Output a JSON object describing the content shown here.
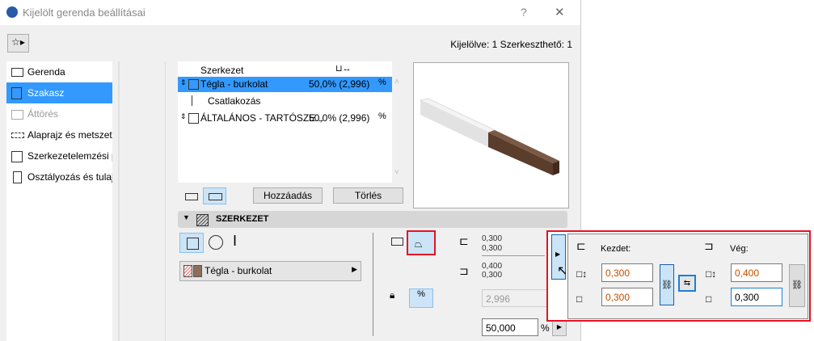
{
  "window": {
    "title": "Kijelölt gerenda beállításai",
    "help": "?",
    "close": "✕"
  },
  "status": "Kijelölve: 1 Szerkeszthető: 1",
  "sidebar": {
    "items": [
      {
        "label": "Gerenda",
        "icon": "beam-icon"
      },
      {
        "label": "Szakasz",
        "icon": "segment-icon",
        "selected": true
      },
      {
        "label": "Áttörés",
        "icon": "hole-icon",
        "disabled": true
      },
      {
        "label": "Alaprajz és metszet",
        "icon": "floorplan-icon"
      },
      {
        "label": "Szerkezetelemzési paraméter...",
        "icon": "structural-icon"
      },
      {
        "label": "Osztályozás és tulajdonságok",
        "icon": "document-icon"
      }
    ]
  },
  "list": {
    "header": "Szerkezet",
    "rows": [
      {
        "name": "Tégla - burkolat",
        "value": "50,0% (2,996)",
        "selected": true
      },
      {
        "name": "Csatlakozás",
        "value": ""
      },
      {
        "name": "ÁLTALÁNOS - TARTÓSZE...",
        "value": "50,0% (2,996)"
      }
    ]
  },
  "buttons": {
    "add": "Hozzáadás",
    "delete": "Törlés"
  },
  "section": {
    "title": "SZERKEZET",
    "material": "Tégla - burkolat",
    "start_values": [
      "0,300",
      "0,300"
    ],
    "end_values": [
      "0,400",
      "0,300"
    ],
    "length": "2,996",
    "percent": "50,000",
    "percent_unit": "%"
  },
  "popup": {
    "start_label": "Kezdet:",
    "end_label": "Vég:",
    "start_height": "0,300",
    "start_width": "0,300",
    "end_height": "0,400",
    "end_width": "0,300"
  },
  "colors": {
    "selection": "#3399ff",
    "highlight": "#e81123",
    "wood": "#5a3d2b"
  }
}
